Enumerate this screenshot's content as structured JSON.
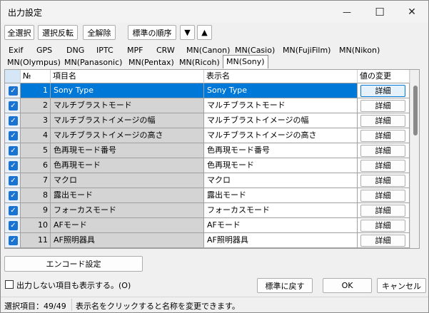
{
  "window": {
    "title": "出力設定",
    "min_glyph": "—",
    "max_glyph": "☐",
    "close_glyph": "✕"
  },
  "toolbar": {
    "select_all": "全選択",
    "invert": "選択反転",
    "clear_all": "全解除",
    "standard_order": "標準の順序",
    "down": "▼",
    "up": "▲"
  },
  "tabs_row1": [
    "Exif",
    "GPS",
    "DNG",
    "IPTC",
    "MPF",
    "CRW",
    "MN(Canon)",
    "MN(Casio)",
    "MN(FujiFilm)",
    "MN(Nikon)"
  ],
  "tabs_row2": [
    "MN(Olympus)",
    "MN(Panasonic)",
    "MN(Pentax)",
    "MN(Ricoh)",
    "MN(Sony)"
  ],
  "grid": {
    "headers": {
      "no": "№",
      "item": "項目名",
      "display": "表示名",
      "change": "値の変更"
    },
    "check_glyph": "✓",
    "detail_label": "詳細",
    "rows": [
      {
        "no": "1",
        "item": "Sony Type",
        "display": "Sony Type"
      },
      {
        "no": "2",
        "item": "マルチブラストモード",
        "display": "マルチブラストモード"
      },
      {
        "no": "3",
        "item": "マルチブラストイメージの幅",
        "display": "マルチブラストイメージの幅"
      },
      {
        "no": "4",
        "item": "マルチブラストイメージの高さ",
        "display": "マルチブラストイメージの高さ"
      },
      {
        "no": "5",
        "item": "色再現モード番号",
        "display": "色再現モード番号"
      },
      {
        "no": "6",
        "item": "色再現モード",
        "display": "色再現モード"
      },
      {
        "no": "7",
        "item": "マクロ",
        "display": "マクロ"
      },
      {
        "no": "8",
        "item": "露出モード",
        "display": "露出モード"
      },
      {
        "no": "9",
        "item": "フォーカスモード",
        "display": "フォーカスモード"
      },
      {
        "no": "10",
        "item": "AFモード",
        "display": "AFモード"
      },
      {
        "no": "11",
        "item": "AF照明器具",
        "display": "AF照明器具"
      }
    ]
  },
  "encode_button": "エンコード設定",
  "show_hidden": {
    "label": "出力しない項目も表示する。(O)"
  },
  "buttons": {
    "reset": "標準に戻す",
    "ok": "OK",
    "cancel": "キャンセル"
  },
  "status": {
    "count": "選択項目：49/49",
    "hint": "表示名をクリックすると名称を変更できます。"
  },
  "colors": {
    "selection": "#0078d7",
    "checkbox": "#1a73d1",
    "item_bg": "#d4d4d4"
  }
}
